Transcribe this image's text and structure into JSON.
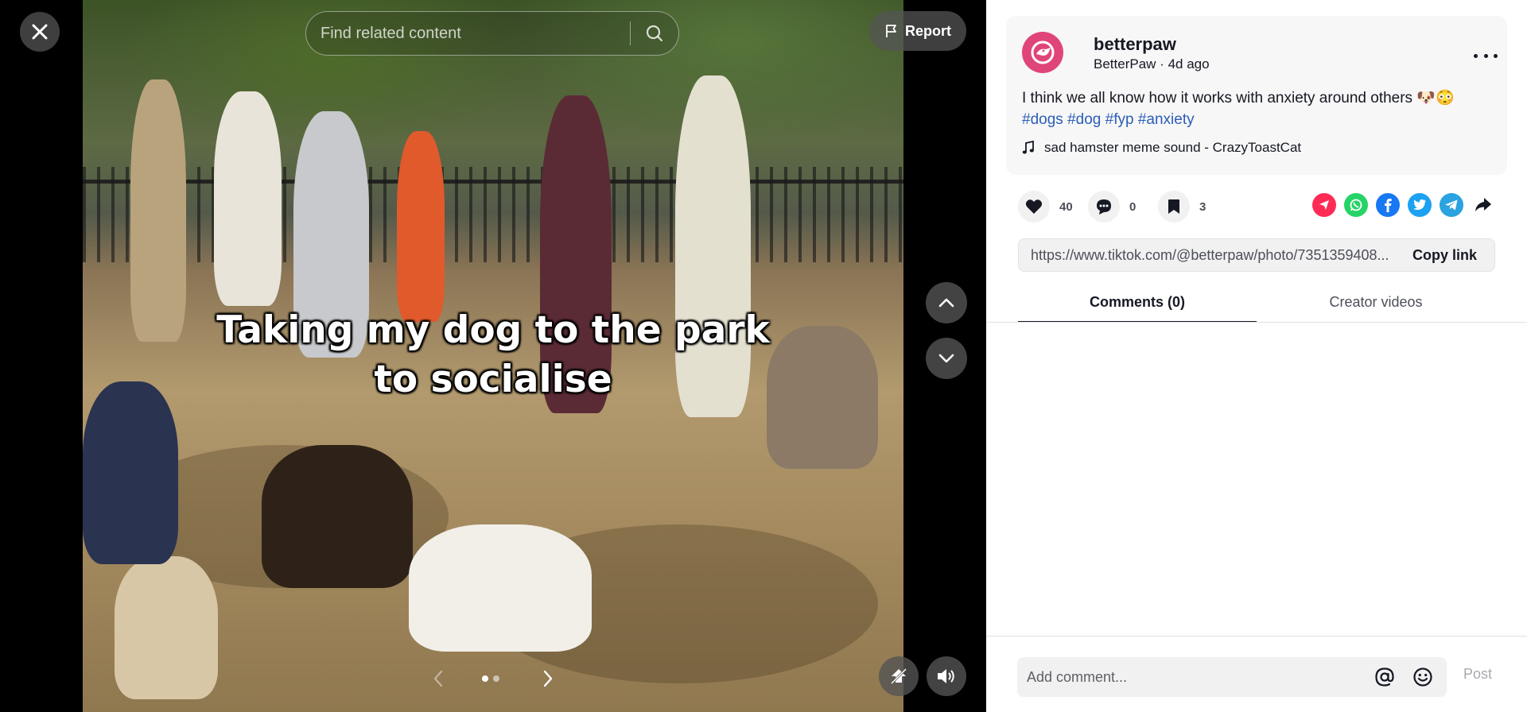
{
  "viewer": {
    "photo_caption": "Taking my dog to the park\nto socialise",
    "search": {
      "placeholder": "Find related content"
    },
    "report_label": "Report",
    "carousel": {
      "slides": 2,
      "active_slide": 1
    },
    "icons": {
      "close": "close-icon",
      "search": "search-icon",
      "report": "flag-icon",
      "prev_video": "chevron-up-icon",
      "next_video": "chevron-down-icon",
      "prev_slide": "chevron-left-icon",
      "next_slide": "chevron-right-icon",
      "float": "floating-player-icon",
      "volume": "volume-icon"
    }
  },
  "post": {
    "username": "betterpaw",
    "display_name": "BetterPaw",
    "posted_ago": "4d ago",
    "description": "I think we all know how it works with anxiety around others 🐶😳",
    "hashtags": [
      "#dogs",
      "#dog",
      "#fyp",
      "#anxiety"
    ],
    "music": "sad hamster meme sound - CrazyToastCat",
    "brand_color": "#e0457a"
  },
  "stats": {
    "likes": "40",
    "comments": "0",
    "saves": "3"
  },
  "share": [
    {
      "name": "send-to-friends",
      "color": "#fe2c55"
    },
    {
      "name": "whatsapp",
      "color": "#25d366"
    },
    {
      "name": "facebook",
      "color": "#1877f2"
    },
    {
      "name": "twitter",
      "color": "#1da1f2"
    },
    {
      "name": "telegram",
      "color": "#2aa3e0"
    },
    {
      "name": "more-share",
      "color": "#161823"
    }
  ],
  "link": {
    "url": "https://www.tiktok.com/@betterpaw/photo/7351359408...",
    "copy_label": "Copy link"
  },
  "tabs": [
    {
      "label": "Comments (0)",
      "active": true
    },
    {
      "label": "Creator videos",
      "active": false
    }
  ],
  "composer": {
    "placeholder": "Add comment...",
    "post_label": "Post"
  }
}
